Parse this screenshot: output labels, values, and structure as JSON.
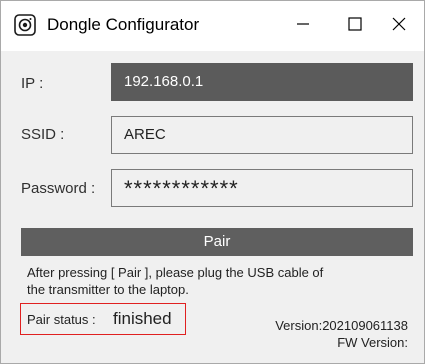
{
  "window": {
    "title": "Dongle Configurator",
    "app_icon": "camera-lens-icon",
    "controls": {
      "minimize_icon": "minimize-icon",
      "maximize_icon": "maximize-icon",
      "close_icon": "close-icon"
    }
  },
  "form": {
    "ip_label": "IP :",
    "ip_value": "192.168.0.1",
    "ssid_label": "SSID :",
    "ssid_value": "AREC",
    "password_label": "Password :",
    "password_value": "************"
  },
  "pair_button": "Pair",
  "hint_text": "After pressing [ Pair ], please plug the USB cable of the transmitter to the laptop.",
  "status": {
    "label": "Pair status :",
    "value": "finished"
  },
  "version": {
    "app": "Version:202109061138",
    "fw": "FW Version:"
  },
  "colors": {
    "active_field_bg": "#5b5b5b",
    "pair_button_bg": "#5f5f5f",
    "status_border": "#e02020"
  }
}
